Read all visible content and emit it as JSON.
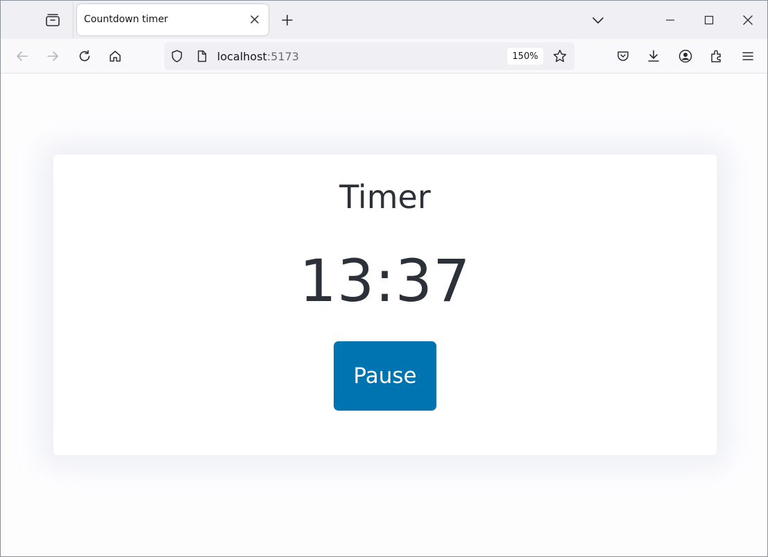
{
  "browser": {
    "tab_title": "Countdown timer",
    "url_host": "localhost",
    "url_port": ":5173",
    "zoom": "150%"
  },
  "page": {
    "title": "Timer",
    "time_display": "13:37",
    "pause_label": "Pause"
  },
  "colors": {
    "button_bg": "#0073b1",
    "text": "#2c3038"
  },
  "icons": {
    "tabstrip": [
      "tab-overview-icon",
      "close-icon",
      "plus-icon",
      "chevron-down-icon",
      "minimize-icon",
      "maximize-icon",
      "close-window-icon"
    ],
    "toolbar": [
      "back-arrow-icon",
      "forward-arrow-icon",
      "reload-icon",
      "home-icon",
      "shield-icon",
      "page-icon",
      "star-icon",
      "pocket-icon",
      "download-icon",
      "account-icon",
      "extensions-icon",
      "menu-icon"
    ]
  }
}
